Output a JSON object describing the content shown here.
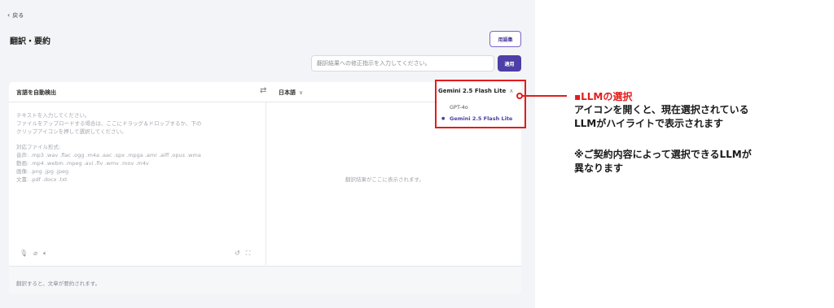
{
  "nav": {
    "back_label": "戻る"
  },
  "header": {
    "title": "翻訳・要約",
    "glossary_label": "用語集"
  },
  "instruction": {
    "placeholder": "翻訳結果への修正指示を入力してください。",
    "apply_label": "適用"
  },
  "languages": {
    "source": "言語を自動検出",
    "target": "日本語"
  },
  "model": {
    "selected": "Gemini 2.5 Flash Lite",
    "options": [
      {
        "label": "GPT-4o",
        "selected": false
      },
      {
        "label": "Gemini 2.5 Flash Lite",
        "selected": true
      }
    ]
  },
  "input": {
    "line1": "テキストを入力してください。",
    "line2": "ファイルをアップロードする場合は、ここにドラッグ＆ドロップするか、下の",
    "line3": "クリップアイコンを押して選択してください。",
    "formats_title": "対応ファイル形式:",
    "audio": "音声: .mp3 .wav .flac .ogg .m4a .aac .spx .mpga .amr .aiff .opus .wma",
    "video": "動画: .mp4 .webm .mpeg .avi .flv .wmv .mov .m4v",
    "image": "画像: .png .jpg .jpeg",
    "document": "文書: .pdf .docx .txt"
  },
  "output": {
    "placeholder": "翻訳結果がここに表示されます。"
  },
  "summary": {
    "placeholder": "翻訳すると、文章が要約されます。"
  },
  "annotation": {
    "title": "▪LLMの選択",
    "body_line1": "アイコンを開くと、現在選択されている",
    "body_line2": "LLMがハイライトで表示されます",
    "note_line1": "※ご契約内容によって選択できるLLMが",
    "note_line2": "異なります"
  },
  "colors": {
    "accent": "#4d3fa6",
    "annotation_red": "#e31c1c"
  }
}
